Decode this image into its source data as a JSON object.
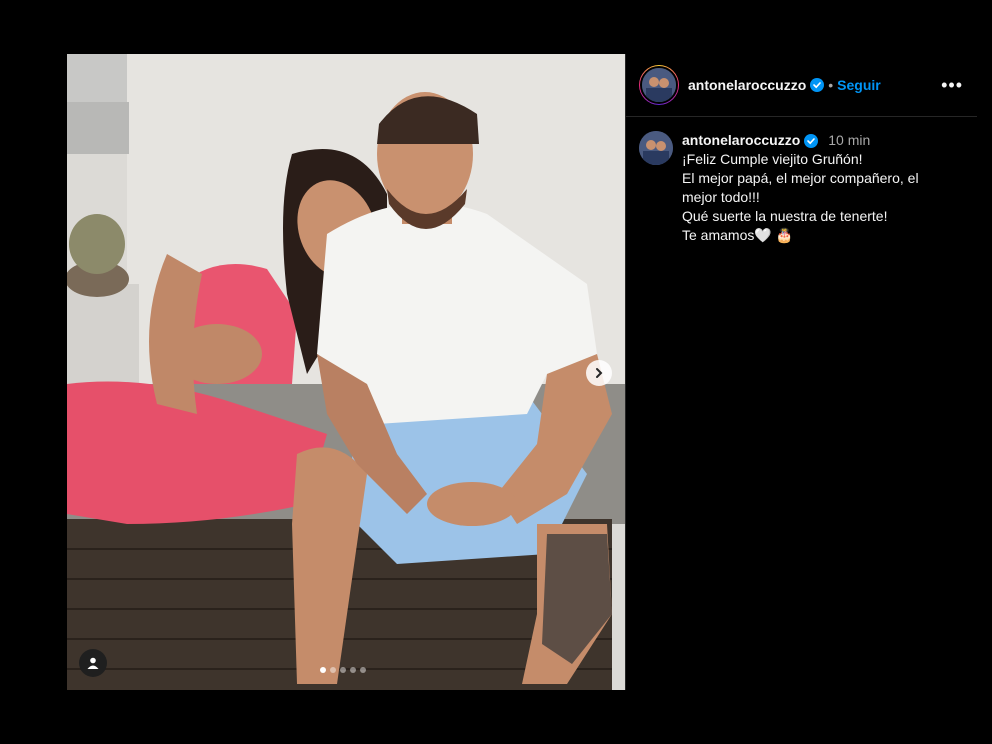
{
  "post": {
    "username": "antonelaroccuzzo",
    "follow_label": "Seguir",
    "separator": "•",
    "more_label": "•••",
    "caption": {
      "username": "antonelaroccuzzo",
      "time": "10 min",
      "lines": [
        "¡Feliz Cumple viejito Gruñón!",
        "El mejor papá, el mejor compañero, el mejor todo!!!",
        "Qué suerte la nuestra de tenerte!",
        "Te amamos🤍 🎂"
      ]
    },
    "carousel": {
      "slide_count": 5,
      "current_index": 0
    },
    "icons": [
      "verified-badge-icon",
      "chevron-right-icon",
      "user-tag-icon",
      "more-options-icon"
    ],
    "colors": {
      "follow": "#0095f6",
      "verified": "#0095f6",
      "background": "#000000",
      "text": "#f5f5f5",
      "muted": "#a8a8a8"
    }
  }
}
